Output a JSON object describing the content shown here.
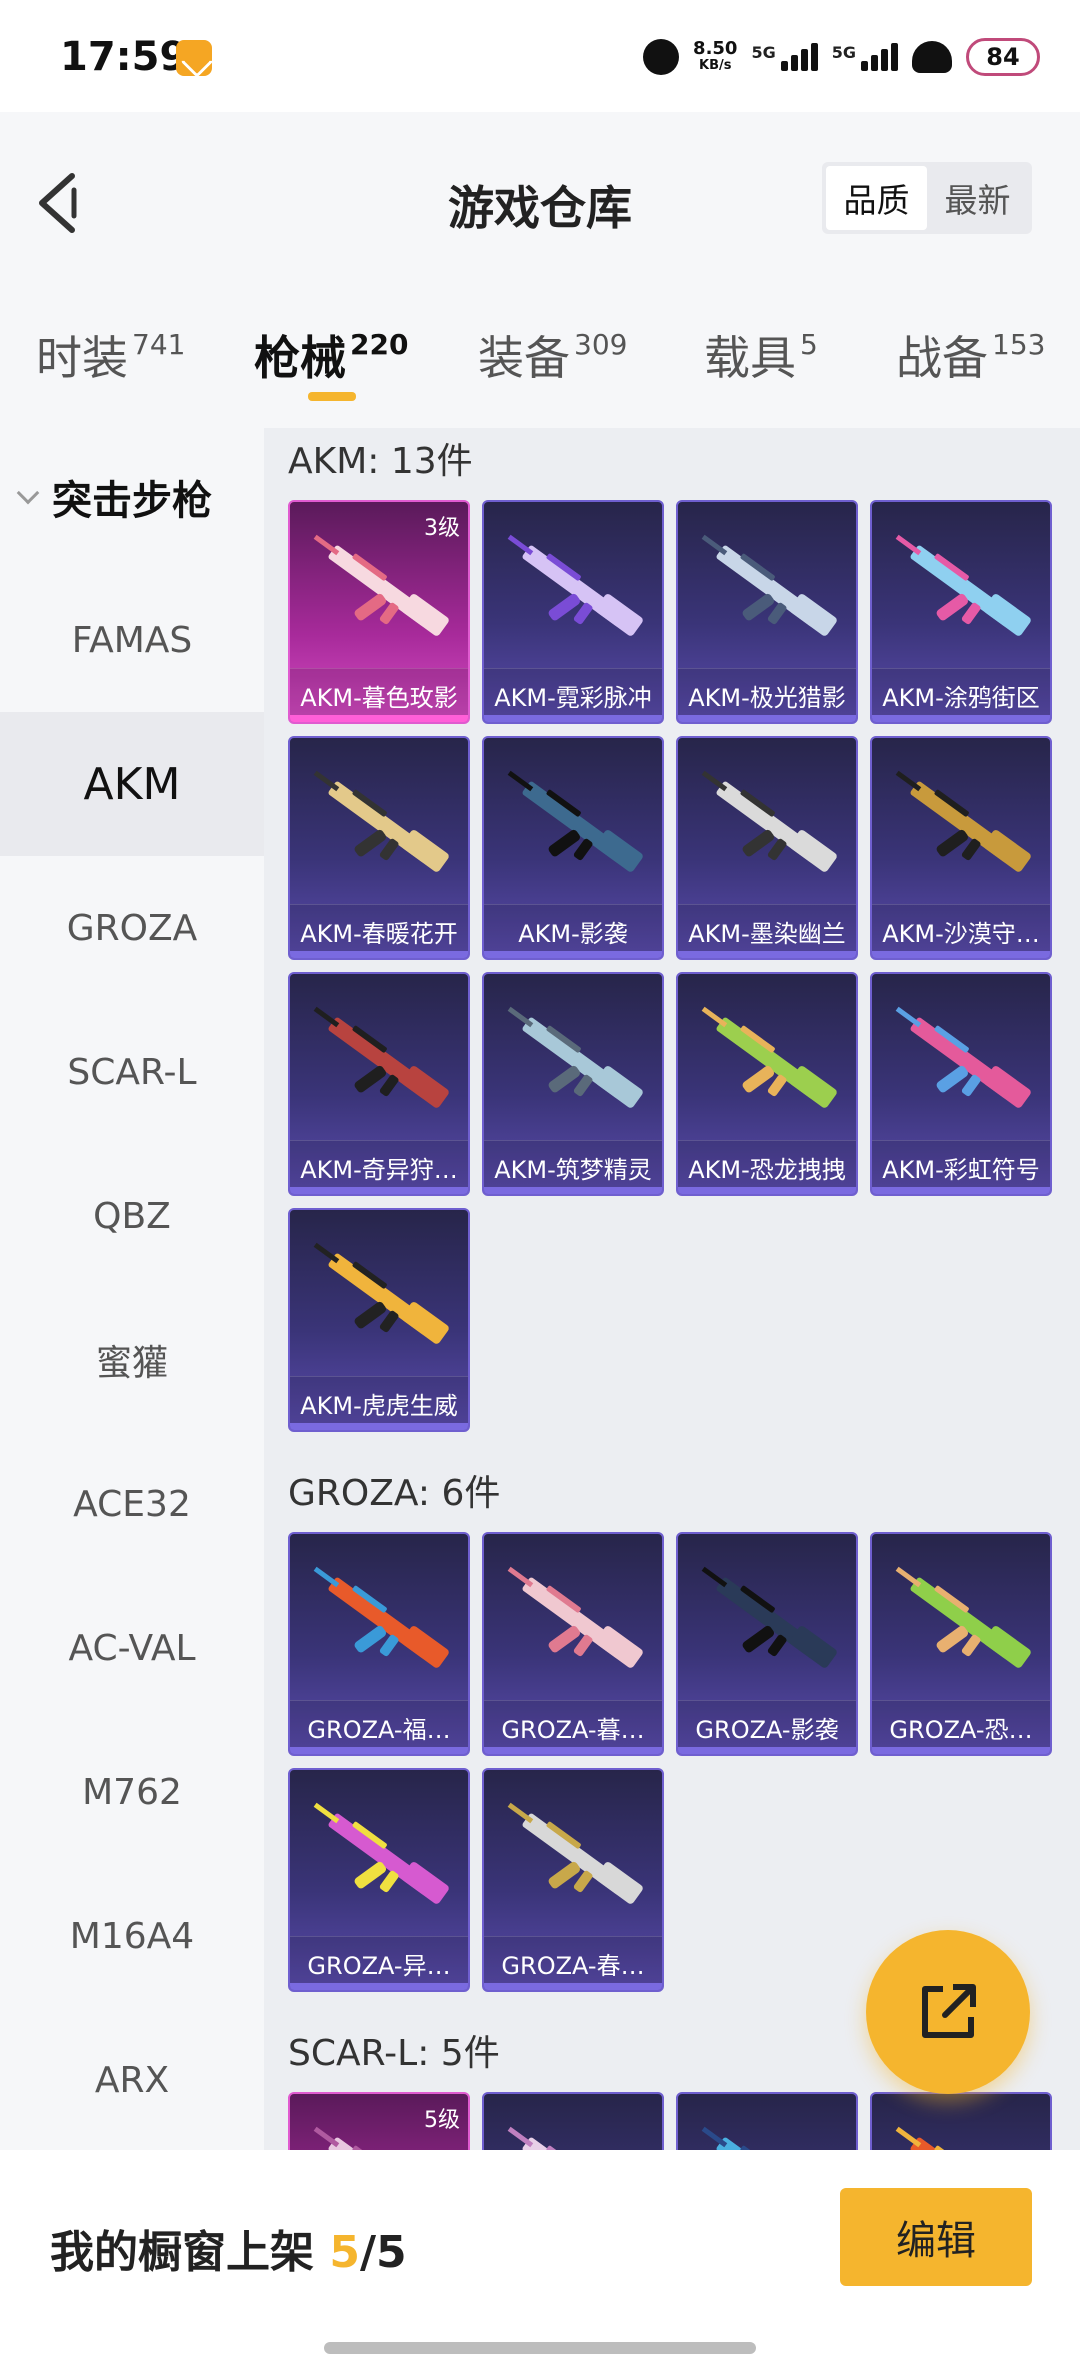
{
  "status_bar": {
    "time": "17:59",
    "net_speed_value": "8.50",
    "net_speed_unit": "KB/s",
    "signal1_label": "5G",
    "signal2_label": "5G",
    "battery": "84"
  },
  "header": {
    "title": "游戏仓库",
    "sort_options": [
      "品质",
      "最新"
    ],
    "sort_active": "品质"
  },
  "tabs": [
    {
      "label": "时装",
      "count": "741"
    },
    {
      "label": "枪械",
      "count": "220",
      "active": true
    },
    {
      "label": "装备",
      "count": "309"
    },
    {
      "label": "载具",
      "count": "5"
    },
    {
      "label": "战备",
      "count": "153"
    }
  ],
  "sidebar": {
    "category": "突击步枪",
    "items": [
      "FAMAS",
      "AKM",
      "GROZA",
      "SCAR-L",
      "QBZ",
      "蜜獾",
      "ACE32",
      "AC-VAL",
      "M762",
      "M16A4",
      "ARX"
    ],
    "active": "AKM"
  },
  "sections": {
    "akm": {
      "title": "AKM: 13件",
      "cards": [
        {
          "name": "AKM-暮色玫影",
          "level": "3级",
          "colors": [
            "#f7d9e0",
            "#e46a84"
          ]
        },
        {
          "name": "AKM-霓彩脉冲",
          "colors": [
            "#d6c3f5",
            "#7a4cd6"
          ]
        },
        {
          "name": "AKM-极光猎影",
          "colors": [
            "#c8d6e8",
            "#4a5b7a"
          ]
        },
        {
          "name": "AKM-涂鸦街区",
          "colors": [
            "#8fd0f0",
            "#e65aa6"
          ]
        },
        {
          "name": "AKM-春暖花开",
          "colors": [
            "#e3c98a",
            "#333333"
          ]
        },
        {
          "name": "AKM-影袭",
          "colors": [
            "#3d6a8f",
            "#111111"
          ]
        },
        {
          "name": "AKM-墨染幽兰",
          "colors": [
            "#dadada",
            "#333333"
          ]
        },
        {
          "name": "AKM-沙漠守…",
          "colors": [
            "#c89a3c",
            "#1f1f1f"
          ]
        },
        {
          "name": "AKM-奇异狩…",
          "colors": [
            "#b8433f",
            "#1f1f1f"
          ]
        },
        {
          "name": "AKM-筑梦精灵",
          "colors": [
            "#a8c8d8",
            "#5a6a7a"
          ]
        },
        {
          "name": "AKM-恐龙拽拽",
          "colors": [
            "#9ccf4e",
            "#e8b35a"
          ]
        },
        {
          "name": "AKM-彩虹符号",
          "colors": [
            "#e45a9b",
            "#5aa0e4"
          ]
        },
        {
          "name": "AKM-虎虎生威",
          "colors": [
            "#f0b43c",
            "#222222"
          ]
        }
      ]
    },
    "groza": {
      "title": "GROZA: 6件",
      "cards": [
        {
          "name": "GROZA-福…",
          "colors": [
            "#e85a2a",
            "#3a9ad8"
          ]
        },
        {
          "name": "GROZA-暮…",
          "colors": [
            "#f0c8d0",
            "#e07a90"
          ]
        },
        {
          "name": "GROZA-影袭",
          "colors": [
            "#2a3a58",
            "#111111"
          ]
        },
        {
          "name": "GROZA-恐…",
          "colors": [
            "#8fcf4a",
            "#e8b070"
          ]
        },
        {
          "name": "GROZA-异…",
          "colors": [
            "#d65ad0",
            "#f0e040"
          ]
        },
        {
          "name": "GROZA-春…",
          "colors": [
            "#d8d8d8",
            "#c8a84a"
          ]
        }
      ]
    },
    "scar": {
      "title": "SCAR-L: 5件",
      "cards": [
        {
          "name": "",
          "level": "5级",
          "colors": [
            "#e8c8e0",
            "#b05aa0"
          ]
        },
        {
          "name": "",
          "colors": [
            "#e8d0e8",
            "#c080c0"
          ]
        },
        {
          "name": "",
          "colors": [
            "#4ab0e0",
            "#2a4a8a"
          ]
        },
        {
          "name": "",
          "colors": [
            "#e85a2a",
            "#f0b43c"
          ]
        }
      ]
    }
  },
  "bottom": {
    "shelf_prefix": "我的橱窗上架 ",
    "shelf_count": "5",
    "shelf_total": "/5",
    "edit_label": "编辑"
  }
}
